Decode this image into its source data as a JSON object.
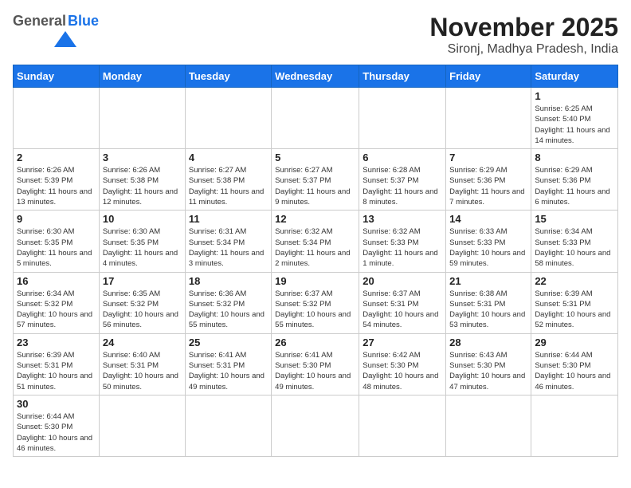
{
  "header": {
    "logo_general": "General",
    "logo_blue": "Blue",
    "title": "November 2025",
    "subtitle": "Sironj, Madhya Pradesh, India"
  },
  "weekdays": [
    "Sunday",
    "Monday",
    "Tuesday",
    "Wednesday",
    "Thursday",
    "Friday",
    "Saturday"
  ],
  "days": {
    "d1": {
      "num": "1",
      "sunrise": "6:25 AM",
      "sunset": "5:40 PM",
      "daylight": "11 hours and 14 minutes."
    },
    "d2": {
      "num": "2",
      "sunrise": "6:26 AM",
      "sunset": "5:39 PM",
      "daylight": "11 hours and 13 minutes."
    },
    "d3": {
      "num": "3",
      "sunrise": "6:26 AM",
      "sunset": "5:38 PM",
      "daylight": "11 hours and 12 minutes."
    },
    "d4": {
      "num": "4",
      "sunrise": "6:27 AM",
      "sunset": "5:38 PM",
      "daylight": "11 hours and 11 minutes."
    },
    "d5": {
      "num": "5",
      "sunrise": "6:27 AM",
      "sunset": "5:37 PM",
      "daylight": "11 hours and 9 minutes."
    },
    "d6": {
      "num": "6",
      "sunrise": "6:28 AM",
      "sunset": "5:37 PM",
      "daylight": "11 hours and 8 minutes."
    },
    "d7": {
      "num": "7",
      "sunrise": "6:29 AM",
      "sunset": "5:36 PM",
      "daylight": "11 hours and 7 minutes."
    },
    "d8": {
      "num": "8",
      "sunrise": "6:29 AM",
      "sunset": "5:36 PM",
      "daylight": "11 hours and 6 minutes."
    },
    "d9": {
      "num": "9",
      "sunrise": "6:30 AM",
      "sunset": "5:35 PM",
      "daylight": "11 hours and 5 minutes."
    },
    "d10": {
      "num": "10",
      "sunrise": "6:30 AM",
      "sunset": "5:35 PM",
      "daylight": "11 hours and 4 minutes."
    },
    "d11": {
      "num": "11",
      "sunrise": "6:31 AM",
      "sunset": "5:34 PM",
      "daylight": "11 hours and 3 minutes."
    },
    "d12": {
      "num": "12",
      "sunrise": "6:32 AM",
      "sunset": "5:34 PM",
      "daylight": "11 hours and 2 minutes."
    },
    "d13": {
      "num": "13",
      "sunrise": "6:32 AM",
      "sunset": "5:33 PM",
      "daylight": "11 hours and 1 minute."
    },
    "d14": {
      "num": "14",
      "sunrise": "6:33 AM",
      "sunset": "5:33 PM",
      "daylight": "10 hours and 59 minutes."
    },
    "d15": {
      "num": "15",
      "sunrise": "6:34 AM",
      "sunset": "5:33 PM",
      "daylight": "10 hours and 58 minutes."
    },
    "d16": {
      "num": "16",
      "sunrise": "6:34 AM",
      "sunset": "5:32 PM",
      "daylight": "10 hours and 57 minutes."
    },
    "d17": {
      "num": "17",
      "sunrise": "6:35 AM",
      "sunset": "5:32 PM",
      "daylight": "10 hours and 56 minutes."
    },
    "d18": {
      "num": "18",
      "sunrise": "6:36 AM",
      "sunset": "5:32 PM",
      "daylight": "10 hours and 55 minutes."
    },
    "d19": {
      "num": "19",
      "sunrise": "6:37 AM",
      "sunset": "5:32 PM",
      "daylight": "10 hours and 55 minutes."
    },
    "d20": {
      "num": "20",
      "sunrise": "6:37 AM",
      "sunset": "5:31 PM",
      "daylight": "10 hours and 54 minutes."
    },
    "d21": {
      "num": "21",
      "sunrise": "6:38 AM",
      "sunset": "5:31 PM",
      "daylight": "10 hours and 53 minutes."
    },
    "d22": {
      "num": "22",
      "sunrise": "6:39 AM",
      "sunset": "5:31 PM",
      "daylight": "10 hours and 52 minutes."
    },
    "d23": {
      "num": "23",
      "sunrise": "6:39 AM",
      "sunset": "5:31 PM",
      "daylight": "10 hours and 51 minutes."
    },
    "d24": {
      "num": "24",
      "sunrise": "6:40 AM",
      "sunset": "5:31 PM",
      "daylight": "10 hours and 50 minutes."
    },
    "d25": {
      "num": "25",
      "sunrise": "6:41 AM",
      "sunset": "5:31 PM",
      "daylight": "10 hours and 49 minutes."
    },
    "d26": {
      "num": "26",
      "sunrise": "6:41 AM",
      "sunset": "5:30 PM",
      "daylight": "10 hours and 49 minutes."
    },
    "d27": {
      "num": "27",
      "sunrise": "6:42 AM",
      "sunset": "5:30 PM",
      "daylight": "10 hours and 48 minutes."
    },
    "d28": {
      "num": "28",
      "sunrise": "6:43 AM",
      "sunset": "5:30 PM",
      "daylight": "10 hours and 47 minutes."
    },
    "d29": {
      "num": "29",
      "sunrise": "6:44 AM",
      "sunset": "5:30 PM",
      "daylight": "10 hours and 46 minutes."
    },
    "d30": {
      "num": "30",
      "sunrise": "6:44 AM",
      "sunset": "5:30 PM",
      "daylight": "10 hours and 46 minutes."
    }
  }
}
